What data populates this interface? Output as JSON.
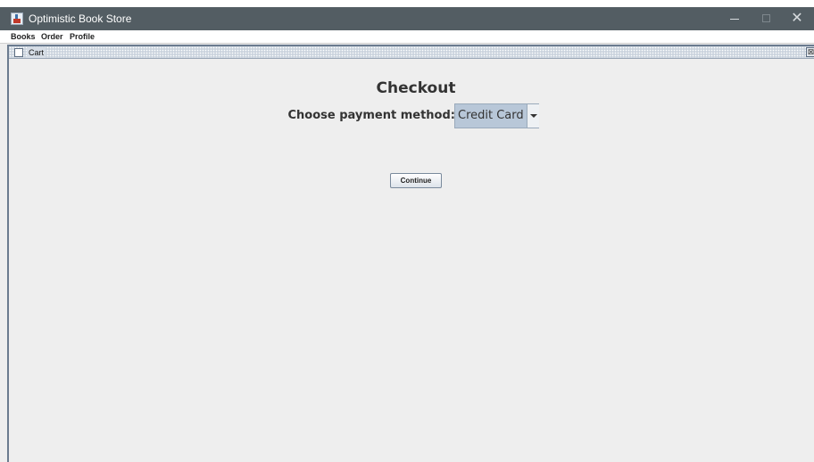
{
  "window": {
    "title": "Optimistic Book Store",
    "controls": {
      "minimize_icon": "minimize-icon",
      "maximize_icon": "maximize-icon",
      "close_icon": "close-icon",
      "close_glyph": "✕"
    }
  },
  "menubar": {
    "items": [
      "Books",
      "Order",
      "Profile"
    ]
  },
  "internal_frame": {
    "title": "Cart",
    "close_glyph": "⊠"
  },
  "checkout": {
    "title": "Checkout",
    "payment_label": "Choose payment method:",
    "payment_selected": "Credit Card",
    "continue_label": "Continue"
  },
  "colors": {
    "titlebar": "#535d63",
    "background": "#eeeeee",
    "select_highlight": "#b8c7d8"
  }
}
